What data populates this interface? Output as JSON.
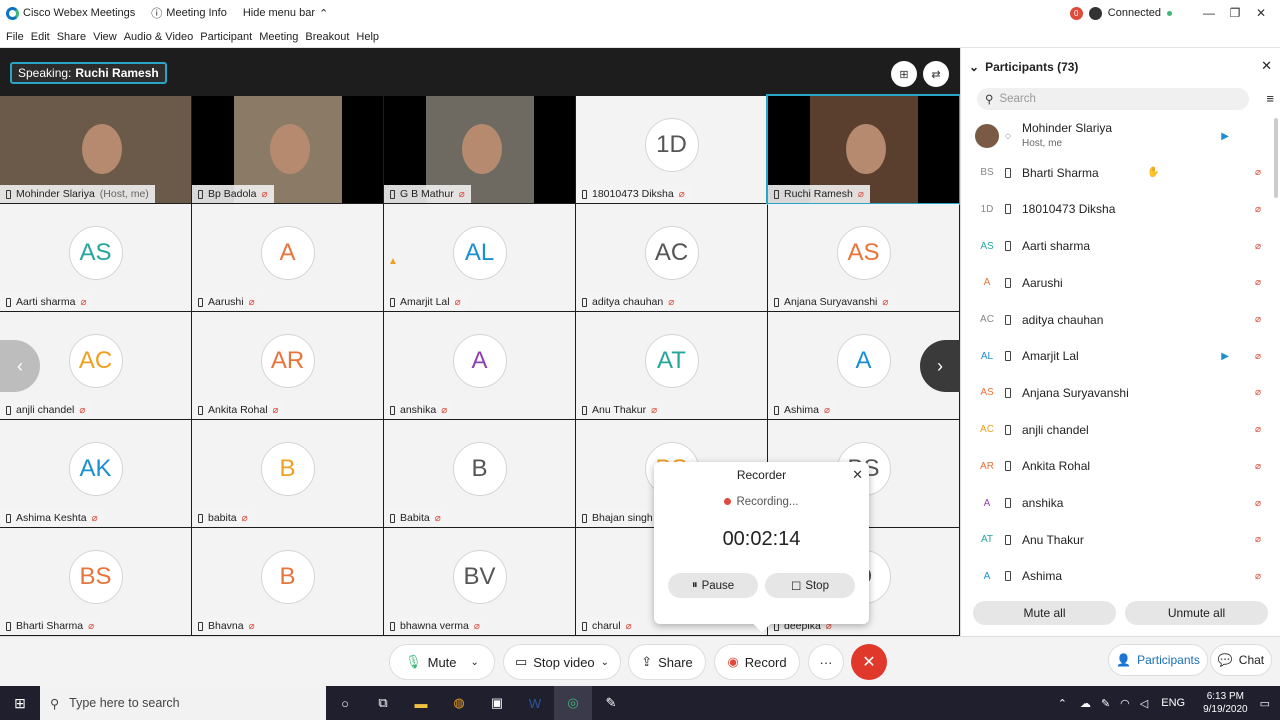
{
  "titlebar": {
    "app_title": "Cisco Webex Meetings",
    "meeting_info": "Meeting Info",
    "hide_menu": "Hide menu bar",
    "notification_count": "0",
    "connection": "Connected"
  },
  "menu": [
    "File",
    "Edit",
    "Share",
    "View",
    "Audio & Video",
    "Participant",
    "Meeting",
    "Breakout",
    "Help"
  ],
  "stage": {
    "speaking_label": "Speaking:",
    "speaking_name": "Ruchi Ramesh"
  },
  "tiles": [
    {
      "name": "Mohinder Slariya",
      "suffix": "(Host, me)",
      "video": true,
      "initials": ""
    },
    {
      "name": "Bp Badola",
      "video": true,
      "initials": ""
    },
    {
      "name": "G B Mathur",
      "video": true,
      "initials": ""
    },
    {
      "name": "18010473 Diksha",
      "video": false,
      "initials": "1D"
    },
    {
      "name": "Ruchi Ramesh",
      "video": true,
      "initials": ""
    },
    {
      "name": "Aarti sharma",
      "video": false,
      "initials": "AS"
    },
    {
      "name": "Aarushi",
      "video": false,
      "initials": "A"
    },
    {
      "name": "Amarjit Lal",
      "video": false,
      "initials": "AL"
    },
    {
      "name": "aditya chauhan",
      "video": false,
      "initials": "AC"
    },
    {
      "name": "Anjana Suryavanshi",
      "video": false,
      "initials": "AS"
    },
    {
      "name": "anjli chandel",
      "video": false,
      "initials": "AC"
    },
    {
      "name": "Ankita Rohal",
      "video": false,
      "initials": "AR"
    },
    {
      "name": "anshika",
      "video": false,
      "initials": "A"
    },
    {
      "name": "Anu Thakur",
      "video": false,
      "initials": "AT"
    },
    {
      "name": "Ashima",
      "video": false,
      "initials": "A"
    },
    {
      "name": "Ashima Keshta",
      "video": false,
      "initials": "AK"
    },
    {
      "name": "babita",
      "video": false,
      "initials": "B"
    },
    {
      "name": "Babita",
      "video": false,
      "initials": "B"
    },
    {
      "name": "Bhajan singh",
      "video": false,
      "initials": "BS"
    },
    {
      "name": "",
      "video": false,
      "initials": "BS"
    },
    {
      "name": "Bharti Sharma",
      "video": false,
      "initials": "BS"
    },
    {
      "name": "Bhavna",
      "video": false,
      "initials": "B"
    },
    {
      "name": "bhawna verma",
      "video": false,
      "initials": "BV"
    },
    {
      "name": "charul",
      "video": false,
      "initials": ""
    },
    {
      "name": "deepika",
      "video": false,
      "initials": "D"
    }
  ],
  "tile_colors": [
    "#333",
    "#333",
    "#333",
    "#555",
    "#333",
    "#26a69a",
    "#e8743b",
    "#1a8fd1",
    "#555",
    "#e8743b",
    "#f0a020",
    "#e8743b",
    "#8e44ad",
    "#26a69a",
    "#1a8fd1",
    "#1a8fd1",
    "#f0a020",
    "#555",
    "#f0a020",
    "#555",
    "#e8743b",
    "#e8743b",
    "#555",
    "#555",
    "#555"
  ],
  "recorder": {
    "title": "Recorder",
    "status": "Recording...",
    "time": "00:02:14",
    "pause": "Pause",
    "stop": "Stop"
  },
  "controls": {
    "mute": "Mute",
    "stop_video": "Stop video",
    "share": "Share",
    "record": "Record",
    "more": "···",
    "participants": "Participants",
    "chat": "Chat"
  },
  "panel": {
    "title": "Participants (73)",
    "search_placeholder": "Search",
    "mute_all": "Mute all",
    "unmute_all": "Unmute all",
    "participants": [
      {
        "initials": "",
        "name": "Mohinder Slariya",
        "sub": "Host, me",
        "cam": true,
        "mic": false,
        "color": "#333"
      },
      {
        "initials": "BS",
        "name": "Bharti Sharma",
        "hand": true,
        "color": "#888"
      },
      {
        "initials": "1D",
        "name": "18010473 Diksha",
        "color": "#888"
      },
      {
        "initials": "AS",
        "name": "Aarti sharma",
        "color": "#26a69a"
      },
      {
        "initials": "A",
        "name": "Aarushi",
        "color": "#e8743b"
      },
      {
        "initials": "AC",
        "name": "aditya chauhan",
        "color": "#888"
      },
      {
        "initials": "AL",
        "name": "Amarjit Lal",
        "cam": true,
        "color": "#1a8fd1"
      },
      {
        "initials": "AS",
        "name": "Anjana Suryavanshi",
        "color": "#e8743b"
      },
      {
        "initials": "AC",
        "name": "anjli chandel",
        "color": "#f0a020"
      },
      {
        "initials": "AR",
        "name": "Ankita Rohal",
        "color": "#e8743b"
      },
      {
        "initials": "A",
        "name": "anshika",
        "color": "#8e44ad"
      },
      {
        "initials": "AT",
        "name": "Anu Thakur",
        "color": "#26a69a"
      },
      {
        "initials": "A",
        "name": "Ashima",
        "color": "#1a8fd1"
      }
    ]
  },
  "taskbar": {
    "search_placeholder": "Type here to search",
    "lang": "ENG",
    "time": "6:13 PM",
    "date": "9/19/2020"
  }
}
